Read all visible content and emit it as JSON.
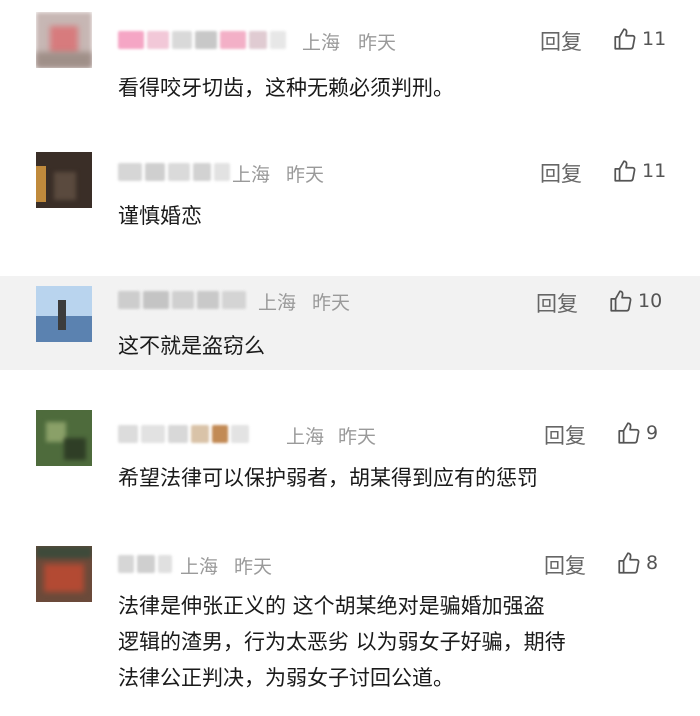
{
  "comments": [
    {
      "location": "上海",
      "time": "昨天",
      "reply_label": "回复",
      "likes": "11",
      "lines": [
        "看得咬牙切齿，这种无赖必须判刑。"
      ]
    },
    {
      "location": "上海",
      "time": "昨天",
      "reply_label": "回复",
      "likes": "11",
      "lines": [
        "谨慎婚恋"
      ]
    },
    {
      "location": "上海",
      "time": "昨天",
      "reply_label": "回复",
      "likes": "10",
      "lines": [
        "这不就是盗窃么"
      ]
    },
    {
      "location": "上海",
      "time": "昨天",
      "reply_label": "回复",
      "likes": "9",
      "lines": [
        "希望法律可以保护弱者，胡某得到应有的惩罚"
      ]
    },
    {
      "location": "上海",
      "time": "昨天",
      "reply_label": "回复",
      "likes": "8",
      "lines": [
        "法律是伸张正义的 这个胡某绝对是骗婚加强盗",
        "逻辑的渣男，行为太恶劣 以为弱女子好骗，期待",
        "法律公正判决，为弱女子讨回公道。"
      ]
    }
  ],
  "icons": {
    "like": "thumbs-up-icon"
  },
  "colors": {
    "highlight_bg": "#f2f2f2",
    "meta_gray": "#9a9a9a"
  }
}
